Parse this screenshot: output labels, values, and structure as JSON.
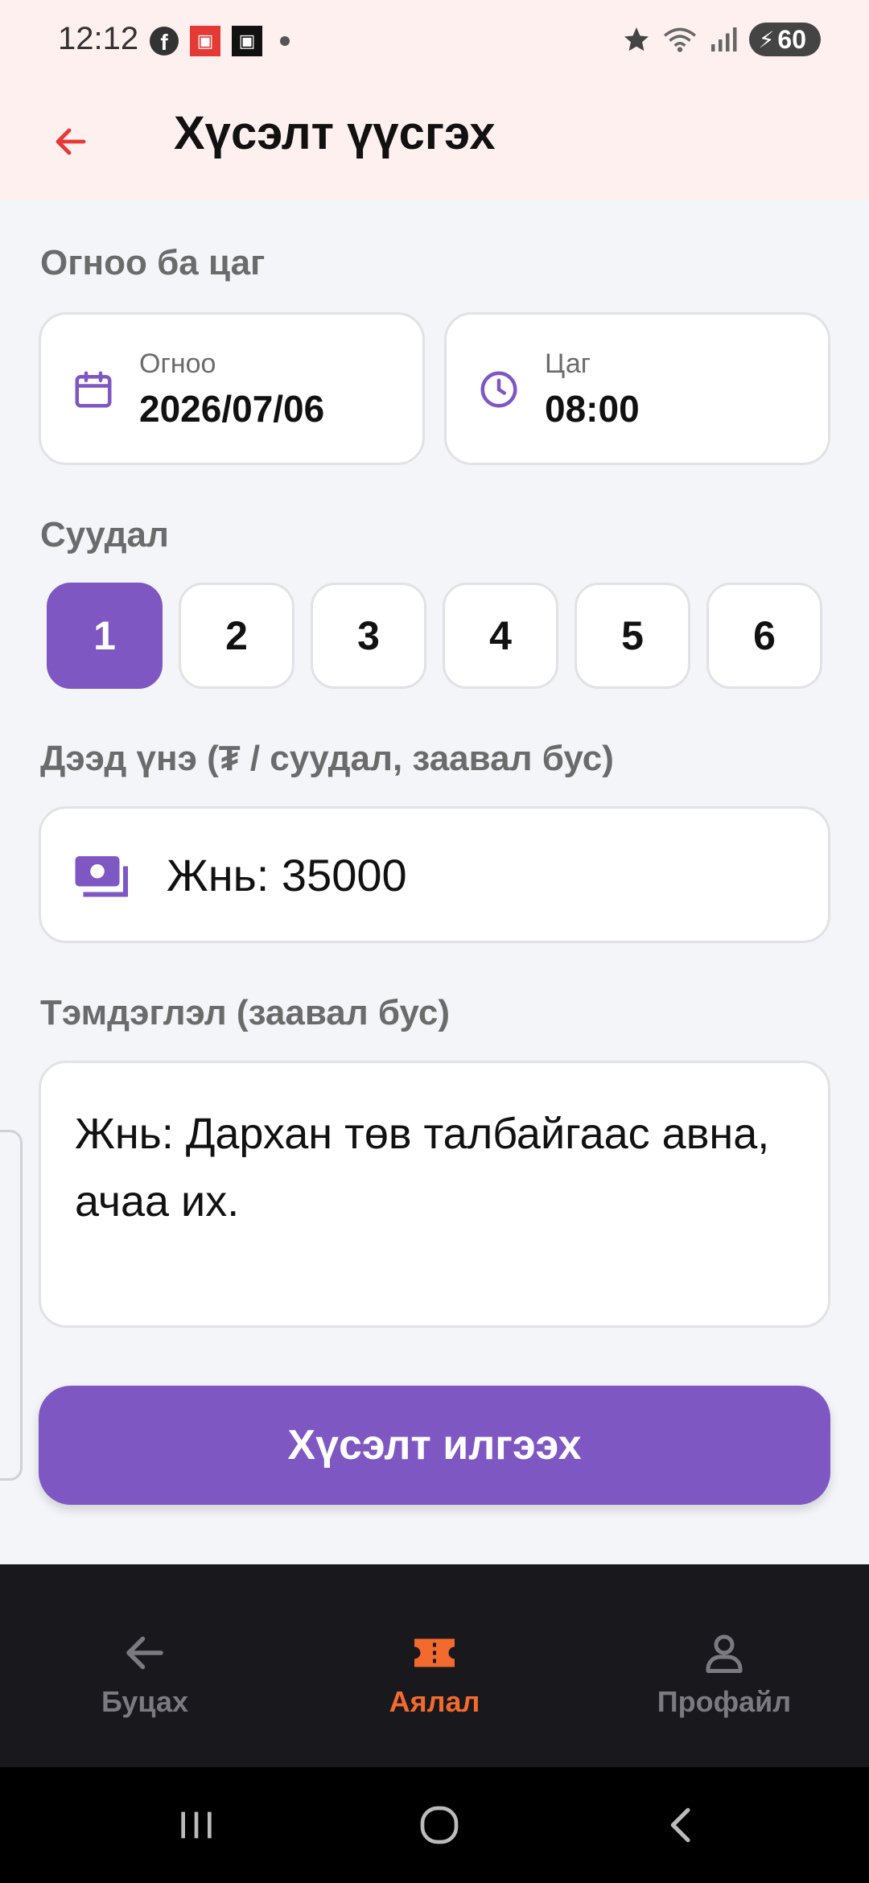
{
  "status_bar": {
    "time": "12:12",
    "battery": "60",
    "icons": [
      "facebook-icon",
      "app-icon-red",
      "app-icon-black",
      "dot-icon",
      "star-icon",
      "wifi-icon",
      "signal-icon",
      "battery-icon"
    ]
  },
  "header": {
    "title": "Хүсэлт үүсгэх"
  },
  "datetime": {
    "section_label": "Огноо ба цаг",
    "date_label": "Огноо",
    "date_value": "2026/07/06",
    "time_label": "Цаг",
    "time_value": "08:00"
  },
  "seats": {
    "section_label": "Суудал",
    "options": [
      "1",
      "2",
      "3",
      "4",
      "5",
      "6"
    ],
    "selected": "1"
  },
  "price": {
    "section_label": "Дээд үнэ (₮ / суудал, заавал бус)",
    "value": "Жнь: 35000"
  },
  "note": {
    "section_label": "Тэмдэглэл (заавал бус)",
    "value": "Жнь: Дархан төв талбайгаас авна, ачаа их."
  },
  "submit_label": "Хүсэлт илгээх",
  "bottom_nav": {
    "items": [
      {
        "label": "Буцах",
        "icon": "arrow-left-icon"
      },
      {
        "label": "Аялал",
        "icon": "ticket-icon",
        "active": true
      },
      {
        "label": "Профайл",
        "icon": "user-icon"
      }
    ]
  },
  "colors": {
    "accent": "#7e57c2",
    "header_bg": "#fff0f0",
    "nav_active": "#f26a2e",
    "back_arrow": "#e53935"
  }
}
